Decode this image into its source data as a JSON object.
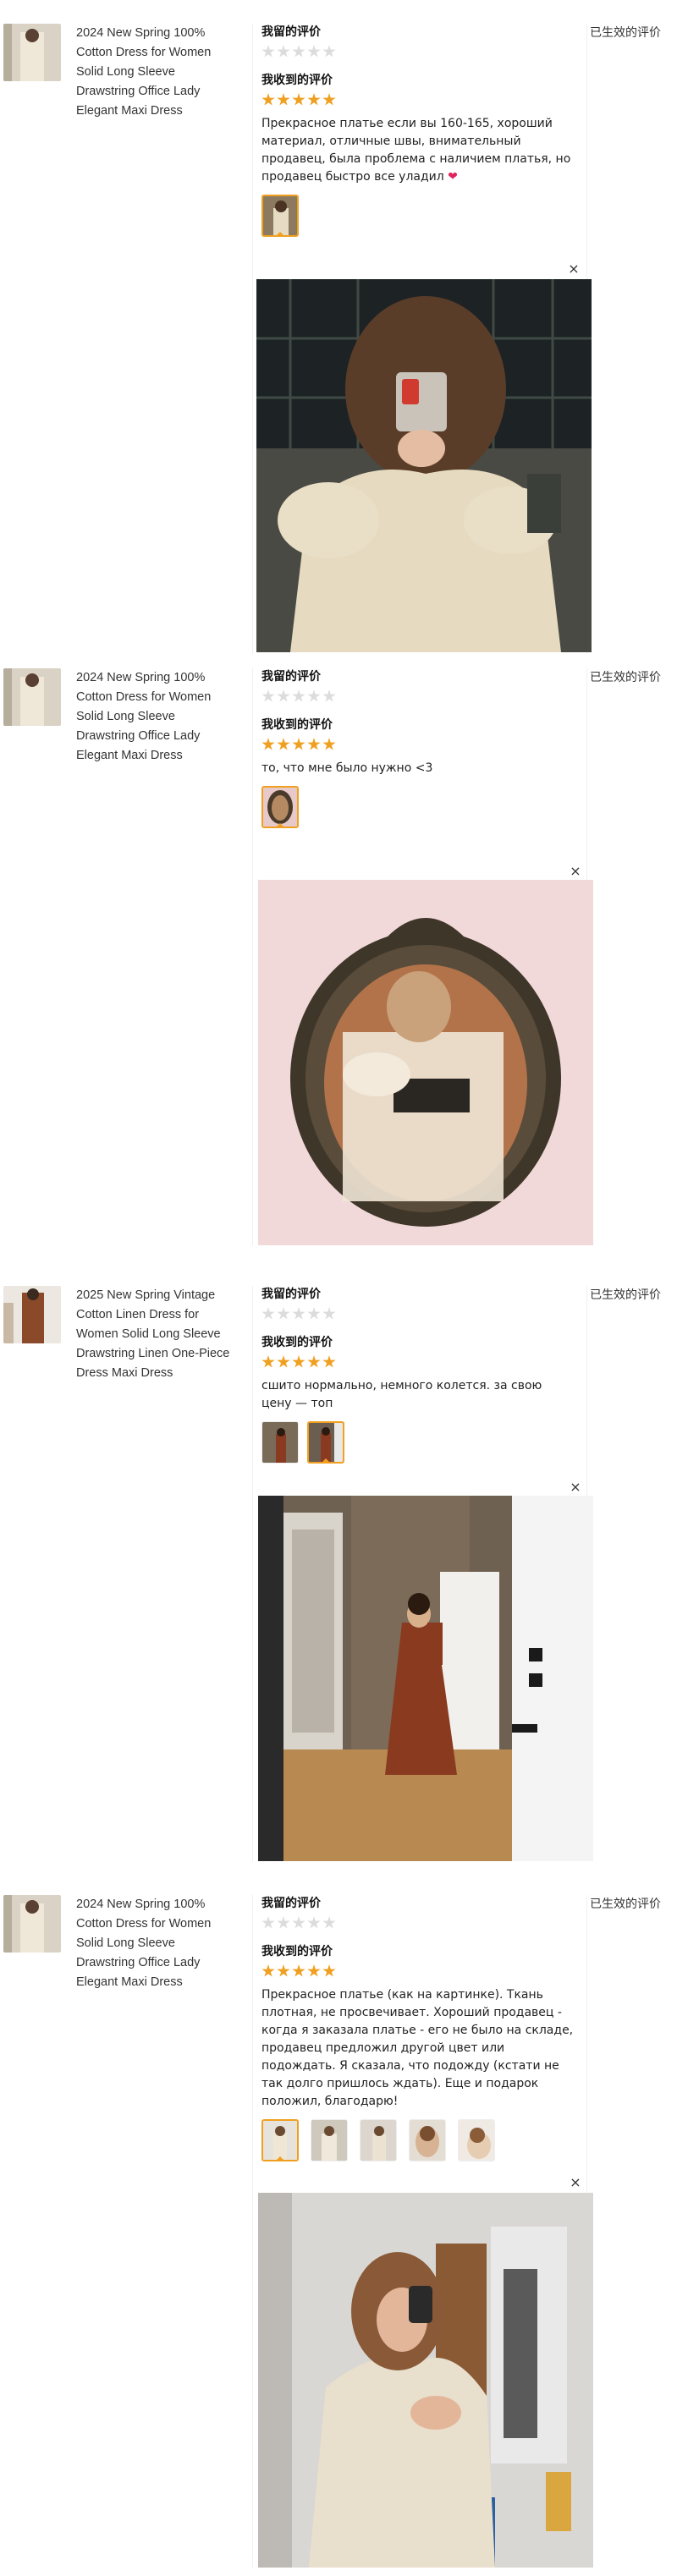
{
  "reviews": [
    {
      "product_title": "2024 New Spring 100% Cotton Dress for Women Solid Long Sleeve Drawstring Office Lady Elegant Maxi Dress",
      "my_review_label": "我留的评价",
      "received_review_label": "我收到的评价",
      "review_text": "Прекрасное платье если вы 160-165, хороший материал, отличные швы, внимательный продавец, была проблема с наличием платья, но продавец быстро все уладил",
      "heart": "❤",
      "my_rating": 0,
      "received_rating": 5,
      "status": "已生效的评价",
      "close": "×",
      "thumbnails": 1
    },
    {
      "product_title": "2024 New Spring 100% Cotton Dress for Women Solid Long Sleeve Drawstring Office Lady Elegant Maxi Dress",
      "my_review_label": "我留的评价",
      "received_review_label": "我收到的评价",
      "review_text": "то, что мне было нужно <3",
      "my_rating": 0,
      "received_rating": 5,
      "status": "已生效的评价",
      "close": "×",
      "thumbnails": 1
    },
    {
      "product_title": "2025 New Spring Vintage Cotton Linen Dress for Women Solid Long Sleeve Drawstring Linen One-Piece Dress Maxi Dress",
      "my_review_label": "我留的评价",
      "received_review_label": "我收到的评价",
      "review_text": "сшито нормально, немного колется. за свою цену — топ",
      "my_rating": 0,
      "received_rating": 5,
      "status": "已生效的评价",
      "close": "×",
      "thumbnails": 2
    },
    {
      "product_title": "2024 New Spring 100% Cotton Dress for Women Solid Long Sleeve Drawstring Office Lady Elegant Maxi Dress",
      "my_review_label": "我留的评价",
      "received_review_label": "我收到的评价",
      "review_text": "Прекрасное платье (как на картинке). Ткань плотная, не просвечивает. Хороший продавец - когда я заказала платье - его не было на складе, продавец предложил другой цвет или подождать. Я сказала, что подожду (кстати не так долго пришлось ждать). Еще и подарок положил, благодарю!",
      "my_rating": 0,
      "received_rating": 5,
      "status": "已生效的评价",
      "close": "×",
      "thumbnails": 5
    }
  ]
}
